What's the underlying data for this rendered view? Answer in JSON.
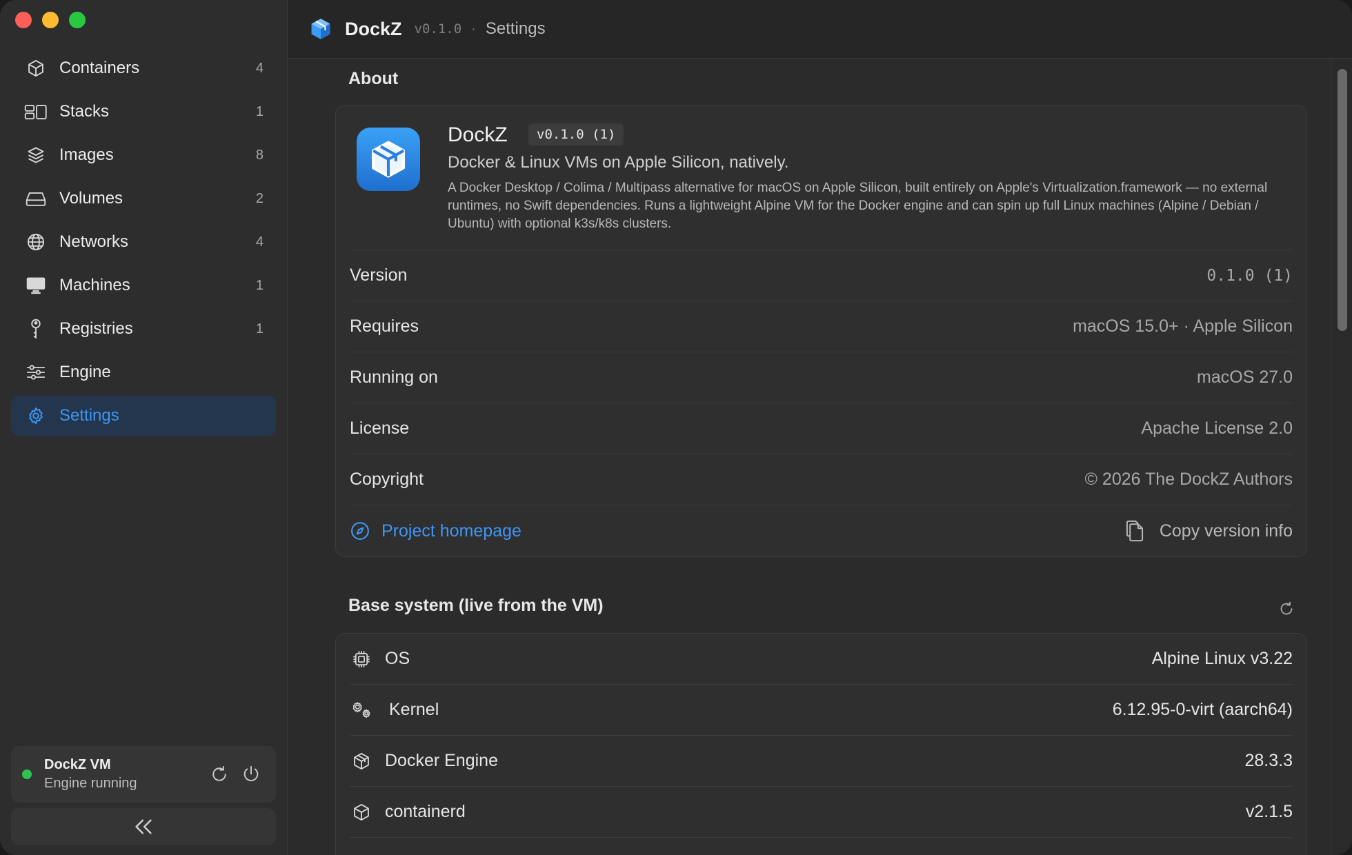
{
  "window": {
    "traffic": [
      "close",
      "minimize",
      "maximize"
    ]
  },
  "sidebar": {
    "items": [
      {
        "label": "Containers",
        "count": "4",
        "icon": "box-icon"
      },
      {
        "label": "Stacks",
        "count": "1",
        "icon": "stacks-icon"
      },
      {
        "label": "Images",
        "count": "8",
        "icon": "layers-icon"
      },
      {
        "label": "Volumes",
        "count": "2",
        "icon": "drive-icon"
      },
      {
        "label": "Networks",
        "count": "4",
        "icon": "globe-icon"
      },
      {
        "label": "Machines",
        "count": "1",
        "icon": "monitor-icon"
      },
      {
        "label": "Registries",
        "count": "1",
        "icon": "key-icon"
      },
      {
        "label": "Engine",
        "count": "",
        "icon": "sliders-icon"
      },
      {
        "label": "Settings",
        "count": "",
        "icon": "gear-icon",
        "active": true
      }
    ],
    "vm": {
      "title": "DockZ VM",
      "status": "Engine running",
      "status_color": "#2fc24e"
    }
  },
  "header": {
    "app_name": "DockZ",
    "version": "v0.1.0",
    "separator": "·",
    "page": "Settings"
  },
  "about": {
    "section_title": "About",
    "app_name": "DockZ",
    "badge": "v0.1.0 (1)",
    "tagline": "Docker & Linux VMs on Apple Silicon, natively.",
    "description": "A Docker Desktop / Colima / Multipass alternative for macOS on Apple Silicon, built entirely on Apple's Virtualization.framework — no external runtimes, no Swift dependencies. Runs a lightweight Alpine VM for the Docker engine and can spin up full Linux machines (Alpine / Debian / Ubuntu) with optional k3s/k8s clusters.",
    "rows": [
      {
        "key": "Version",
        "value": "0.1.0 (1)"
      },
      {
        "key": "Requires",
        "value": "macOS 15.0+ · Apple Silicon"
      },
      {
        "key": "Running on",
        "value": "macOS 27.0"
      },
      {
        "key": "License",
        "value": "Apache License 2.0"
      },
      {
        "key": "Copyright",
        "value": "© 2026 The DockZ Authors"
      }
    ],
    "homepage_label": "Project homepage",
    "copy_label": "Copy version info"
  },
  "base_system": {
    "section_title": "Base system (live from the VM)",
    "rows": [
      {
        "key": "OS",
        "value": "Alpine Linux v3.22",
        "icon": "chip-icon"
      },
      {
        "key": "Kernel",
        "value": "6.12.95-0-virt (aarch64)",
        "icon": "gears-icon"
      },
      {
        "key": "Docker Engine",
        "value": "28.3.3",
        "icon": "box-icon"
      },
      {
        "key": "containerd",
        "value": "v2.1.5",
        "icon": "box-icon"
      }
    ]
  },
  "colors": {
    "accent": "#3e95f5",
    "active_bg": "#23364e"
  }
}
